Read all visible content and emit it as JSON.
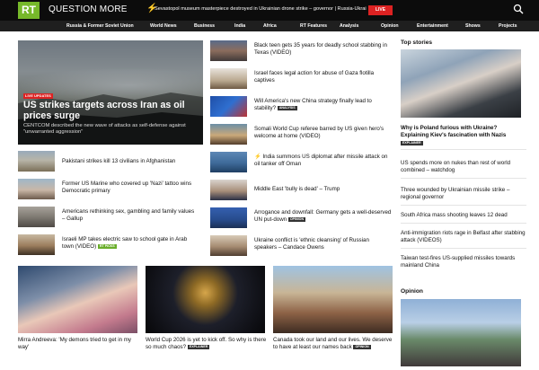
{
  "header": {
    "logo_text": "RT",
    "slogan": "QUESTION MORE",
    "ticker": "Sevastopol museum masterpiece destroyed in Ukrainian drone strike – governor | Russia-Ukraine conflict",
    "live_label": "LIVE"
  },
  "nav": [
    "Russia & Former Soviet Union",
    "World News",
    "Business",
    "India",
    "Africa",
    "RT Features",
    "Analysis",
    "Opinion",
    "Entertainment",
    "Shows",
    "Projects"
  ],
  "feature": {
    "badge": "LIVE UPDATES",
    "title": "US strikes targets across Iran as oil prices surge",
    "subtitle": "CENTCOM described the new wave of attacks as self-defense against \"unwarranted aggression\""
  },
  "left_list": [
    {
      "text": "Pakistani strikes kill 13 civilians in Afghanistan"
    },
    {
      "text": "Former US Marine who covered up 'Nazi' tattoo wins Democratic primary"
    },
    {
      "text": "Americans rethinking sex, gambling and family values – Gallup"
    },
    {
      "text": "Israeli MP takes electric saw to school gate in Arab town (VIDEO)",
      "tag": "RT PICKS"
    }
  ],
  "mid_list": [
    {
      "text": "Black teen gets 35 years for deadly school stabbing in Texas (VIDEO)"
    },
    {
      "text": "Israel faces legal action for abuse of Gaza flotilla captives"
    },
    {
      "text": "Will America's new China strategy finally lead to stability?",
      "tag": "ANALYSIS"
    },
    {
      "text": "Somali World Cup referee barred by US given hero's welcome at home (VIDEO)"
    },
    {
      "text": "India summons US diplomat after missile attack on oil tanker off Oman",
      "bolt": true
    },
    {
      "text": "Middle East 'bully is dead' – Trump"
    },
    {
      "text": "Arrogance and downfall: Germany gets a well-deserved UN put-down",
      "tag": "OPINION"
    },
    {
      "text": "Ukraine conflict is 'ethnic cleansing' of Russian speakers – Candace Owens"
    }
  ],
  "tiles": [
    {
      "text": "Mirra Andreeva: 'My demons tried to get in my way'"
    },
    {
      "text": "World Cup 2026 is yet to kick off. So why is there so much chaos?",
      "tag": "EXPLAINER"
    },
    {
      "text": "Canada took our land and our lives. We deserve to have at least our names back",
      "tag": "OPINION"
    }
  ],
  "sidebar": {
    "top_heading": "Top stories",
    "top_stories": [
      {
        "text": "Why is Poland furious with Ukraine? Explaining Kiev's fascination with Nazis",
        "tag": "EXPLAINER",
        "bold": true
      },
      {
        "text": "US spends more on nukes than rest of world combined – watchdog"
      },
      {
        "text": "Three wounded by Ukrainian missile strike – regional governor"
      },
      {
        "text": "South Africa mass shooting leaves 12 dead"
      },
      {
        "text": "Anti-immigration riots rage in Belfast after stabbing attack (VIDEOS)"
      },
      {
        "text": "Taiwan test-fires US-supplied missiles towards mainland China"
      }
    ],
    "opinion_heading": "Opinion"
  },
  "colors": {
    "brand_green": "#76b82a",
    "live_red": "#dd2222",
    "header_bg": "#0c0c0c",
    "nav_bg": "#1f1f1f"
  },
  "icons": {
    "search": "search-icon",
    "bolt": "lightning-icon"
  }
}
